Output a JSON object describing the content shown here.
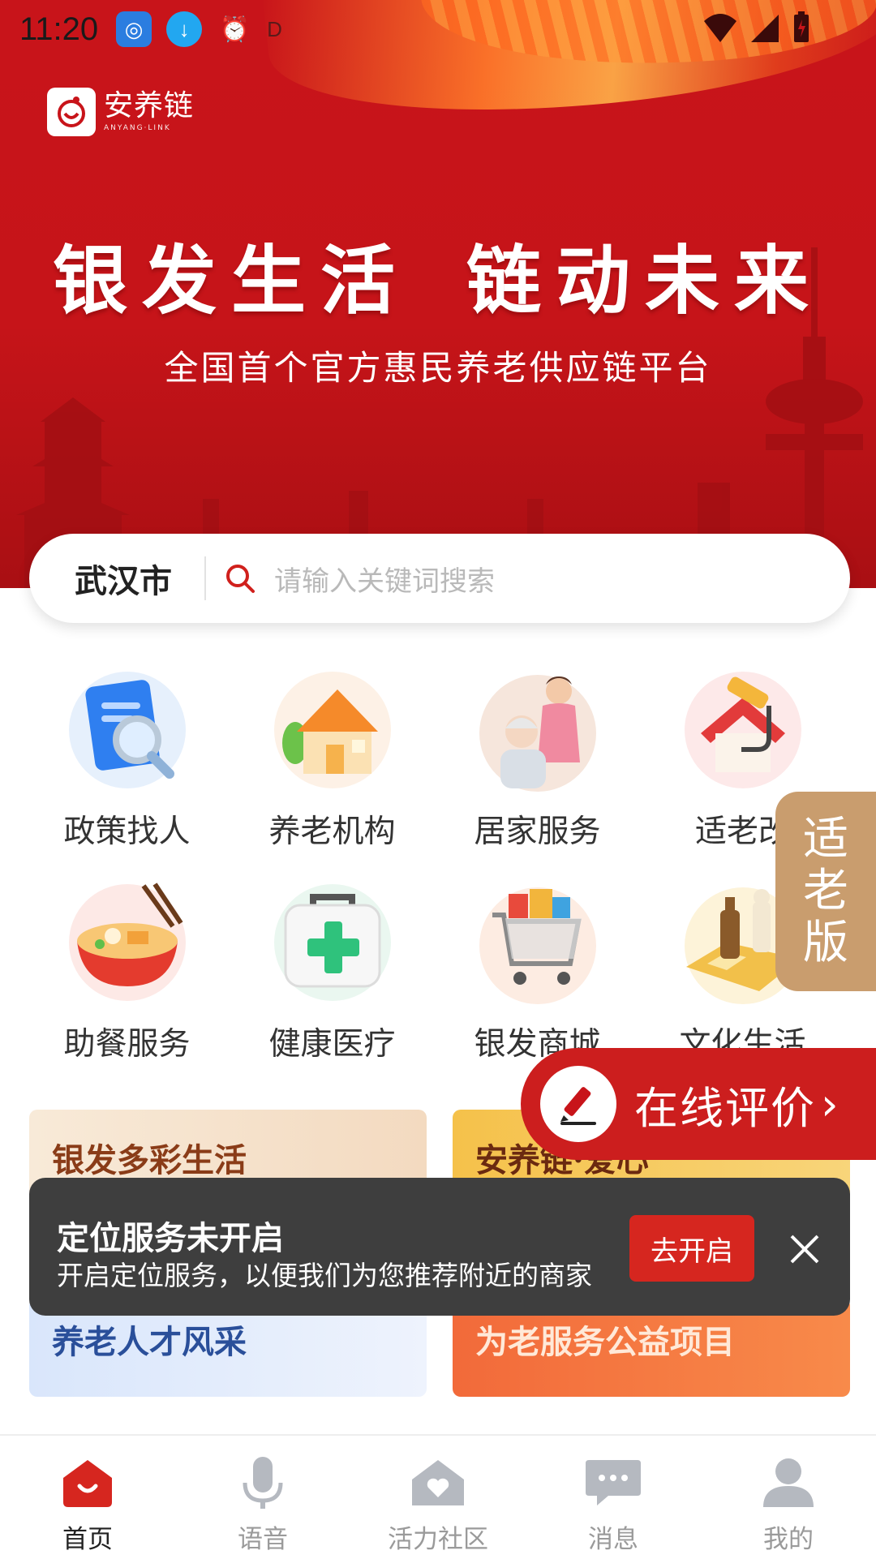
{
  "status_bar": {
    "time": "11:20",
    "extra_letter": "D"
  },
  "brand": {
    "name": "安养链",
    "sub": "ANYANG·LINK"
  },
  "hero": {
    "slogan_left": "银发生活",
    "slogan_right": "链动未来",
    "subtitle": "全国首个官方惠民养老供应链平台"
  },
  "search": {
    "city": "武汉市",
    "placeholder": "请输入关键词搜索"
  },
  "categories": [
    {
      "label": "政策找人",
      "icon": "document-search-icon"
    },
    {
      "label": "养老机构",
      "icon": "house-icon"
    },
    {
      "label": "居家服务",
      "icon": "caregiver-icon"
    },
    {
      "label": "适老改",
      "icon": "home-renovation-icon"
    },
    {
      "label": "助餐服务",
      "icon": "noodle-bowl-icon"
    },
    {
      "label": "健康医疗",
      "icon": "first-aid-kit-icon"
    },
    {
      "label": "银发商城",
      "icon": "shopping-cart-icon"
    },
    {
      "label": "文化生活",
      "icon": "chess-icon"
    }
  ],
  "elder_tab": {
    "c1": "适",
    "c2": "老",
    "c3": "版"
  },
  "review": {
    "label": "在线评价",
    "arrow": "›"
  },
  "cards": [
    {
      "title": "银发多彩生活"
    },
    {
      "title": "安养链·爱心"
    },
    {
      "title": "养老人才风采"
    },
    {
      "title": "为老服务公益项目"
    }
  ],
  "toast": {
    "title": "定位服务未开启",
    "desc": "开启定位服务，以便我们为您推荐附近的商家",
    "button": "去开启"
  },
  "tabbar": [
    {
      "label": "首页",
      "icon": "home-icon",
      "active": true
    },
    {
      "label": "语音",
      "icon": "microphone-icon",
      "active": false
    },
    {
      "label": "活力社区",
      "icon": "community-icon",
      "active": false
    },
    {
      "label": "消息",
      "icon": "message-icon",
      "active": false
    },
    {
      "label": "我的",
      "icon": "user-icon",
      "active": false
    }
  ],
  "colors": {
    "primary": "#cc1e1e",
    "hero": "#c8141a",
    "elder_tab": "#c99d6e",
    "toast_bg": "#3e3e3e"
  }
}
